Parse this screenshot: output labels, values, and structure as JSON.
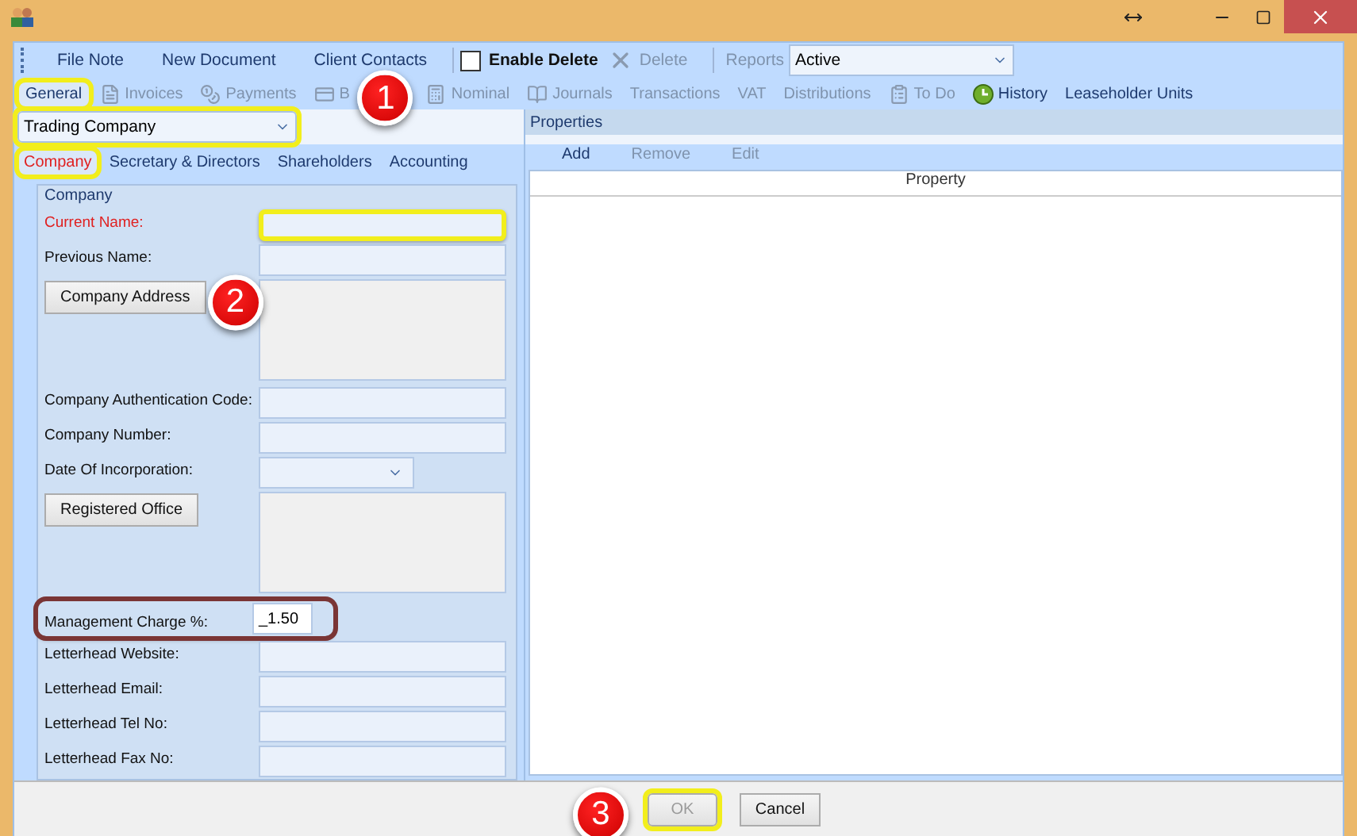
{
  "toolbar": {
    "items": [
      {
        "label": "File Note"
      },
      {
        "label": "New Document"
      },
      {
        "label": "Client Contacts"
      }
    ],
    "enable_delete": {
      "label": "Enable Delete",
      "checked": false
    },
    "delete": {
      "label": "Delete",
      "disabled": true
    },
    "reports": {
      "label": "Reports",
      "disabled": true
    },
    "status_combo": {
      "value": "Active"
    }
  },
  "tabs": [
    {
      "label": "General",
      "selected": true,
      "disabled": false,
      "has_icon": false,
      "highlighted": true
    },
    {
      "label": "Invoices",
      "selected": false,
      "disabled": true,
      "has_icon": true,
      "highlighted": false
    },
    {
      "label": "Payments",
      "selected": false,
      "disabled": true,
      "has_icon": true,
      "highlighted": false
    },
    {
      "label": "B",
      "selected": false,
      "disabled": true,
      "has_icon": true,
      "highlighted": false,
      "callout": "1"
    },
    {
      "label": "Nominal",
      "selected": false,
      "disabled": true,
      "has_icon": true,
      "highlighted": false
    },
    {
      "label": "Journals",
      "selected": false,
      "disabled": true,
      "has_icon": true,
      "highlighted": false
    },
    {
      "label": "Transactions",
      "selected": false,
      "disabled": true,
      "has_icon": false,
      "highlighted": false
    },
    {
      "label": "VAT",
      "selected": false,
      "disabled": true,
      "has_icon": false,
      "highlighted": false
    },
    {
      "label": "Distributions",
      "selected": false,
      "disabled": true,
      "has_icon": false,
      "highlighted": false
    },
    {
      "label": "To Do",
      "selected": false,
      "disabled": true,
      "has_icon": true,
      "highlighted": false
    },
    {
      "label": "History",
      "selected": false,
      "disabled": false,
      "has_icon": true,
      "highlighted": false
    },
    {
      "label": "Leaseholder Units",
      "selected": false,
      "disabled": false,
      "has_icon": false,
      "highlighted": false
    }
  ],
  "company_type": {
    "value": "Trading Company",
    "highlighted": true
  },
  "subtabs": [
    {
      "label": "Company",
      "selected": true,
      "highlighted": true
    },
    {
      "label": "Secretary & Directors",
      "selected": false,
      "highlighted": false
    },
    {
      "label": "Shareholders",
      "selected": false,
      "highlighted": false
    },
    {
      "label": "Accounting",
      "selected": false,
      "highlighted": false
    }
  ],
  "group_title": "Company",
  "fields": [
    {
      "kind": "text",
      "label": "Current Name:",
      "required": true,
      "highlighted": true
    },
    {
      "kind": "text",
      "label": "Previous Name:",
      "required": false,
      "highlighted": false
    },
    {
      "kind": "button_area",
      "label": "Company Address",
      "callout": "2"
    },
    {
      "kind": "text",
      "label": "Company Authentication Code:",
      "required": false,
      "highlighted": false
    },
    {
      "kind": "text",
      "label": "Company Number:",
      "required": false,
      "highlighted": false
    },
    {
      "kind": "date",
      "label": "Date Of Incorporation:"
    },
    {
      "kind": "button_area",
      "label": "Registered Office"
    },
    {
      "kind": "short",
      "label": "Management Charge %:",
      "value": "_1.50",
      "framed": true
    },
    {
      "kind": "text",
      "label": "Letterhead Website:",
      "required": false,
      "highlighted": false
    },
    {
      "kind": "text",
      "label": "Letterhead Email:",
      "required": false,
      "highlighted": false
    },
    {
      "kind": "text",
      "label": "Letterhead Tel No:",
      "required": false,
      "highlighted": false
    },
    {
      "kind": "text",
      "label": "Letterhead Fax No:",
      "required": false,
      "highlighted": false
    }
  ],
  "properties": {
    "title": "Properties",
    "actions": [
      {
        "label": "Add",
        "disabled": false
      },
      {
        "label": "Remove",
        "disabled": true
      },
      {
        "label": "Edit",
        "disabled": true
      }
    ],
    "column": "Property"
  },
  "buttons": [
    {
      "label": "OK",
      "disabled": true,
      "highlighted": true,
      "callout": "3"
    },
    {
      "label": "Cancel",
      "disabled": false,
      "highlighted": false
    }
  ]
}
